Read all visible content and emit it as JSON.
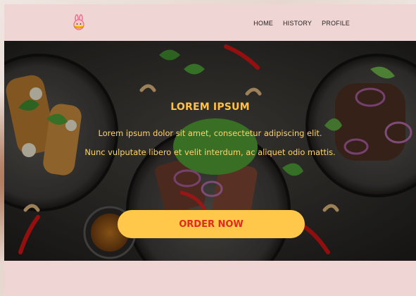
{
  "brand": {
    "logo_icon": "bunny-icon",
    "accent": "#e96b8f"
  },
  "nav": {
    "items": [
      {
        "label": "HOME"
      },
      {
        "label": "HISTORY"
      },
      {
        "label": "PROFILE"
      }
    ]
  },
  "hero": {
    "title": "LOREM IPSUM",
    "line1": "Lorem ipsum dolor sit amet, consectetur adipiscing elit.",
    "line2": "Nunc vulputate libero et velit interdum, ac aliquet odio mattis.",
    "cta_label": "ORDER NOW",
    "background": "food-platter-image"
  },
  "colors": {
    "page_bg": "#efd5d3",
    "title": "#ffc247",
    "text": "#ffd36a",
    "cta_bg": "#ffc84a",
    "cta_text": "#e02b1e"
  }
}
